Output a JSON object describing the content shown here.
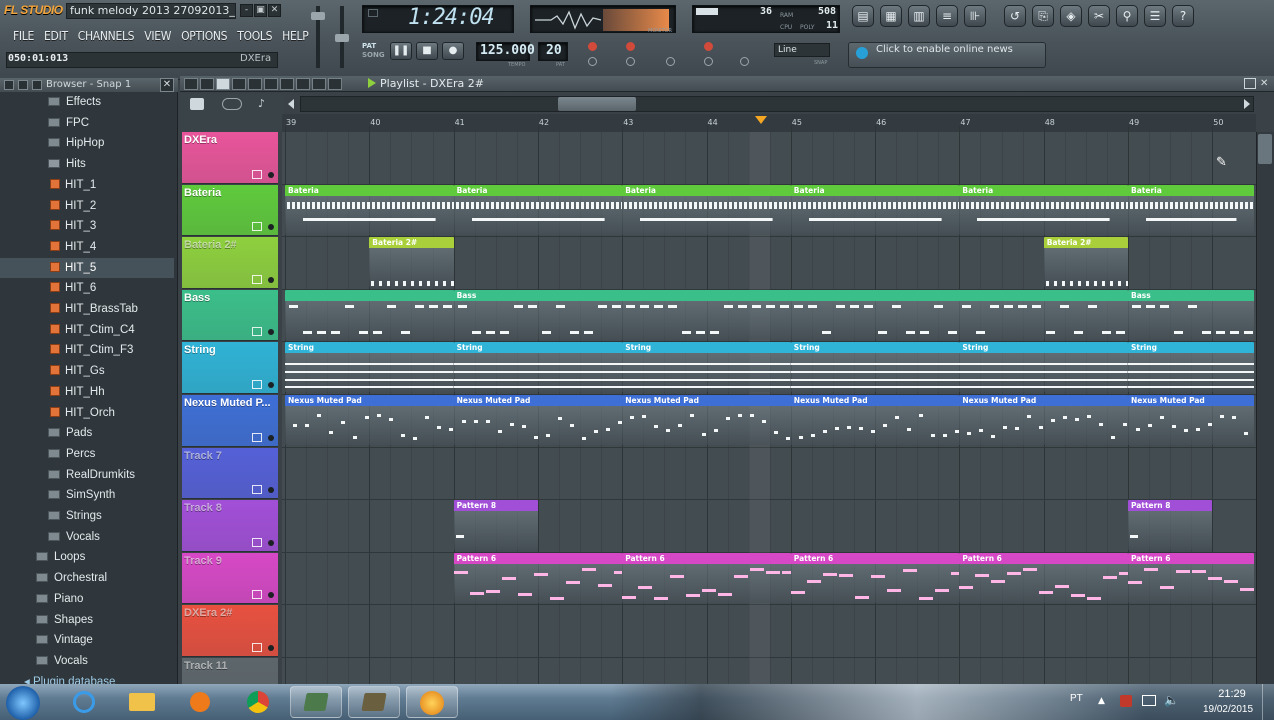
{
  "window": {
    "logo": "FL STUDIO",
    "title": "funk melody 2013 27092013_2....",
    "controls": [
      "-",
      "▣",
      "✕"
    ]
  },
  "menu": [
    "FILE",
    "EDIT",
    "CHANNELS",
    "VIEW",
    "OPTIONS",
    "TOOLS",
    "HELP"
  ],
  "hint": {
    "position": "050:01:013",
    "channel": "DXEra"
  },
  "transport": {
    "time": "1:24:04",
    "tempo": "125.000",
    "pattern": "20",
    "pat_song": [
      "PAT",
      "SONG"
    ],
    "tempo_label": "TEMPO",
    "pattern_label": "PAT",
    "snap": "Line",
    "snap_label": "SNAP",
    "scope_label": "MONITOR"
  },
  "cpu": {
    "value1": "36",
    "value2": "508",
    "value3": "11",
    "labels": [
      "RAM",
      "CPU",
      "POLY"
    ]
  },
  "news": "Click to enable online news",
  "browser": {
    "title": "Browser - Snap 1",
    "items": [
      {
        "label": "Effects",
        "type": "folder",
        "indent": 2
      },
      {
        "label": "FPC",
        "type": "folder",
        "indent": 2
      },
      {
        "label": "HipHop",
        "type": "folder",
        "indent": 2
      },
      {
        "label": "Hits",
        "type": "folder-open",
        "indent": 2
      },
      {
        "label": "HIT_1",
        "type": "file",
        "indent": 3
      },
      {
        "label": "HIT_2",
        "type": "file",
        "indent": 3
      },
      {
        "label": "HIT_3",
        "type": "file",
        "indent": 3
      },
      {
        "label": "HIT_4",
        "type": "file",
        "indent": 3
      },
      {
        "label": "HIT_5",
        "type": "file",
        "indent": 3,
        "selected": true
      },
      {
        "label": "HIT_6",
        "type": "file",
        "indent": 3
      },
      {
        "label": "HIT_BrassTab",
        "type": "file",
        "indent": 3
      },
      {
        "label": "HIT_Ctim_C4",
        "type": "file",
        "indent": 3
      },
      {
        "label": "HIT_Ctim_F3",
        "type": "file",
        "indent": 3
      },
      {
        "label": "HIT_Gs",
        "type": "file",
        "indent": 3
      },
      {
        "label": "HIT_Hh",
        "type": "file",
        "indent": 3
      },
      {
        "label": "HIT_Orch",
        "type": "file",
        "indent": 3
      },
      {
        "label": "Pads",
        "type": "folder",
        "indent": 2
      },
      {
        "label": "Percs",
        "type": "folder",
        "indent": 2
      },
      {
        "label": "RealDrumkits",
        "type": "folder",
        "indent": 2
      },
      {
        "label": "SimSynth",
        "type": "folder",
        "indent": 2
      },
      {
        "label": "Strings",
        "type": "folder",
        "indent": 2
      },
      {
        "label": "Vocals",
        "type": "folder",
        "indent": 2
      },
      {
        "label": "Loops",
        "type": "folder",
        "indent": 1
      },
      {
        "label": "Orchestral",
        "type": "folder",
        "indent": 1
      },
      {
        "label": "Piano",
        "type": "folder",
        "indent": 1
      },
      {
        "label": "Shapes",
        "type": "folder",
        "indent": 1
      },
      {
        "label": "Vintage",
        "type": "folder",
        "indent": 1
      },
      {
        "label": "Vocals",
        "type": "folder",
        "indent": 1
      },
      {
        "label": "Plugin database",
        "type": "db",
        "indent": 0
      }
    ]
  },
  "playlist": {
    "title": "Playlist - DXEra 2#",
    "bars": [
      "39",
      "40",
      "41",
      "42",
      "43",
      "44",
      "45",
      "46",
      "47",
      "48",
      "49",
      "50"
    ],
    "tracks": [
      {
        "name": "DXEra",
        "color": "#e8559a",
        "dim": false
      },
      {
        "name": "Bateria",
        "color": "#5fca3c",
        "dim": false
      },
      {
        "name": "Bateria 2#",
        "color": "#8ed03e",
        "dim": true
      },
      {
        "name": "Bass",
        "color": "#3bbf8a",
        "dim": false
      },
      {
        "name": "String",
        "color": "#2fb3d6",
        "dim": false
      },
      {
        "name": "Nexus Muted P...",
        "color": "#3e6fd6",
        "dim": false
      },
      {
        "name": "Track 7",
        "color": "#5560d8",
        "dim": true
      },
      {
        "name": "Track 8",
        "color": "#a24fd8",
        "dim": true
      },
      {
        "name": "Track 9",
        "color": "#d748c6",
        "dim": true
      },
      {
        "name": "DXEra 2#",
        "color": "#e8503f",
        "dim": true
      },
      {
        "name": "Track 11",
        "color": "#5d666b",
        "dim": true
      }
    ],
    "clips": [
      {
        "track": 1,
        "label": "Bateria",
        "start": 39,
        "len": 2,
        "color": "#5fca3c"
      },
      {
        "track": 1,
        "label": "Bateria",
        "start": 41,
        "len": 2,
        "color": "#5fca3c"
      },
      {
        "track": 1,
        "label": "Bateria",
        "start": 43,
        "len": 2,
        "color": "#5fca3c"
      },
      {
        "track": 1,
        "label": "Bateria",
        "start": 45,
        "len": 2,
        "color": "#5fca3c"
      },
      {
        "track": 1,
        "label": "Bateria",
        "start": 47,
        "len": 2,
        "color": "#5fca3c"
      },
      {
        "track": 1,
        "label": "Bateria",
        "start": 49,
        "len": 1.5,
        "color": "#5fca3c"
      },
      {
        "track": 2,
        "label": "Bateria 2#",
        "start": 40,
        "len": 1,
        "color": "#a9d03a"
      },
      {
        "track": 2,
        "label": "Bateria 2#",
        "start": 48,
        "len": 1,
        "color": "#a9d03a"
      },
      {
        "track": 3,
        "label": "",
        "start": 39,
        "len": 2,
        "color": "#3bbf8a"
      },
      {
        "track": 3,
        "label": "Bass",
        "start": 41,
        "len": 8,
        "color": "#3bbf8a"
      },
      {
        "track": 3,
        "label": "Bass",
        "start": 49,
        "len": 1.5,
        "color": "#3bbf8a"
      },
      {
        "track": 4,
        "label": "String",
        "start": 39,
        "len": 2,
        "color": "#2fb3d6"
      },
      {
        "track": 4,
        "label": "String",
        "start": 41,
        "len": 2,
        "color": "#2fb3d6"
      },
      {
        "track": 4,
        "label": "String",
        "start": 43,
        "len": 2,
        "color": "#2fb3d6"
      },
      {
        "track": 4,
        "label": "String",
        "start": 45,
        "len": 2,
        "color": "#2fb3d6"
      },
      {
        "track": 4,
        "label": "String",
        "start": 47,
        "len": 2,
        "color": "#2fb3d6"
      },
      {
        "track": 4,
        "label": "String",
        "start": 49,
        "len": 1.5,
        "color": "#2fb3d6"
      },
      {
        "track": 5,
        "label": "Nexus Muted Pad",
        "start": 39,
        "len": 2,
        "color": "#3e6fd6"
      },
      {
        "track": 5,
        "label": "Nexus Muted Pad",
        "start": 41,
        "len": 2,
        "color": "#3e6fd6"
      },
      {
        "track": 5,
        "label": "Nexus Muted Pad",
        "start": 43,
        "len": 2,
        "color": "#3e6fd6"
      },
      {
        "track": 5,
        "label": "Nexus Muted Pad",
        "start": 45,
        "len": 2,
        "color": "#3e6fd6"
      },
      {
        "track": 5,
        "label": "Nexus Muted Pad",
        "start": 47,
        "len": 2,
        "color": "#3e6fd6"
      },
      {
        "track": 5,
        "label": "Nexus Muted Pad",
        "start": 49,
        "len": 1.5,
        "color": "#3e6fd6"
      },
      {
        "track": 7,
        "label": "Pattern 8",
        "start": 41,
        "len": 1,
        "color": "#a24fd8"
      },
      {
        "track": 7,
        "label": "Pattern 8",
        "start": 49,
        "len": 1,
        "color": "#a24fd8"
      },
      {
        "track": 8,
        "label": "Pattern 6",
        "start": 41,
        "len": 2,
        "color": "#d748c6"
      },
      {
        "track": 8,
        "label": "Pattern 6",
        "start": 43,
        "len": 2,
        "color": "#d748c6"
      },
      {
        "track": 8,
        "label": "Pattern 6",
        "start": 45,
        "len": 2,
        "color": "#d748c6"
      },
      {
        "track": 8,
        "label": "Pattern 6",
        "start": 47,
        "len": 2,
        "color": "#d748c6"
      },
      {
        "track": 8,
        "label": "Pattern 6",
        "start": 49,
        "len": 1.5,
        "color": "#d748c6"
      }
    ],
    "playhead_bar": 44.65
  },
  "taskbar": {
    "apps": [
      "start",
      "ie",
      "explorer",
      "media",
      "chrome",
      "app1",
      "app2",
      "fl-studio"
    ],
    "lang": "PT",
    "time": "21:29",
    "date": "19/02/2015"
  }
}
